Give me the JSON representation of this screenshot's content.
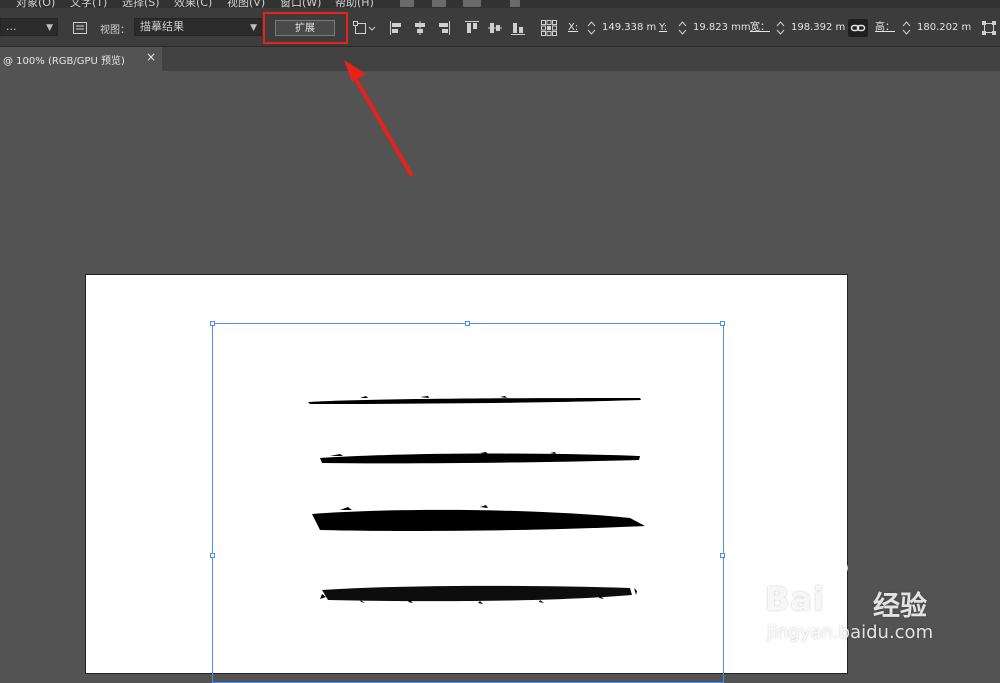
{
  "menu": {
    "items": [
      "对象(O)",
      "文字(T)",
      "选择(S)",
      "效果(C)",
      "视图(V)",
      "窗口(W)",
      "帮助(H)"
    ]
  },
  "control_bar": {
    "preset_value": "...",
    "view_label": "视图：",
    "view_value": "描摹结果",
    "expand_label": "扩展",
    "x_label": "X:",
    "x_value": "149.338 m",
    "y_label": "Y:",
    "y_value": "19.823 mm",
    "w_label": "宽：",
    "w_value": "198.392 m",
    "h_label": "高：",
    "h_value": "180.202 m"
  },
  "tab": {
    "title": "@ 100% (RGB/GPU 预览)",
    "close": "×"
  },
  "watermark": {
    "brand": "Bai",
    "brand_cn": "经验",
    "url": "jingyan.baidu.com"
  },
  "colors": {
    "highlight": "#e8211a",
    "selection": "#4a8ff0",
    "artboard": "#ffffff",
    "workspace": "#535353"
  }
}
